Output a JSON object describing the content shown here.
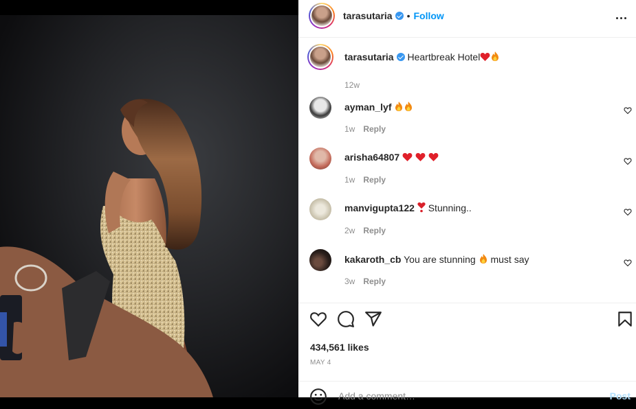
{
  "post": {
    "author": "tarasutaria",
    "follow_label": "Follow",
    "separator": "•",
    "caption_text": "Heartbreak Hotel",
    "caption_age": "12w",
    "likes": "434,561 likes",
    "date": "MAY 4"
  },
  "comments": [
    {
      "user": "ayman_lyf",
      "text": "",
      "emojis": [
        "fire",
        "fire"
      ],
      "age": "1w",
      "reply": "Reply"
    },
    {
      "user": "arisha64807",
      "text": "",
      "emojis": [
        "heart",
        "heart",
        "heart"
      ],
      "age": "1w",
      "reply": "Reply"
    },
    {
      "user": "manvigupta122",
      "text": "Stunning..",
      "emojis": [
        "exclamation-heart"
      ],
      "age": "2w",
      "reply": "Reply"
    },
    {
      "user": "kakaroth_cb",
      "text_before": "You are stunning",
      "text_after": "must say",
      "emojis": [
        "fire"
      ],
      "age": "3w",
      "reply": "Reply"
    }
  ],
  "add_comment": {
    "placeholder": "Add a comment…",
    "post_label": "Post"
  },
  "icons": {
    "verified": "verified-badge-icon",
    "more": "more-options-icon",
    "like": "heart-outline-icon",
    "comment": "comment-bubble-icon",
    "share": "paper-plane-icon",
    "save": "bookmark-icon",
    "emoji": "smiley-icon"
  },
  "colors": {
    "link": "#0095f6",
    "verified": "#3897f0",
    "muted": "#8e8e8e",
    "text": "#262626"
  }
}
